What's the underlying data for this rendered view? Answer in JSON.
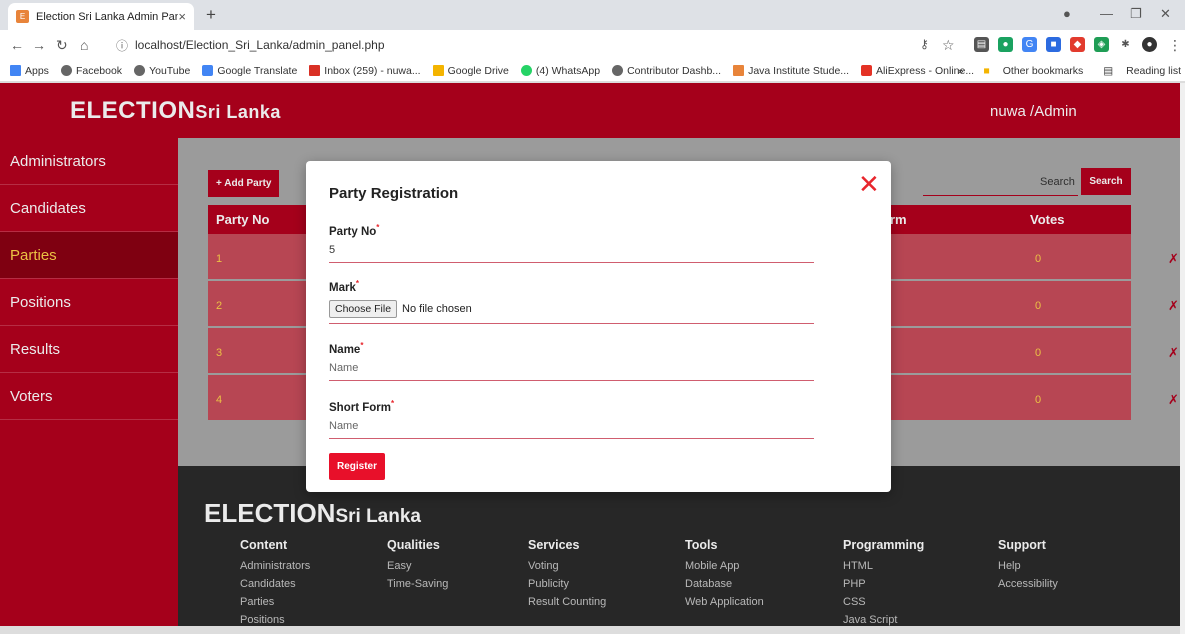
{
  "browser": {
    "tab_title": "Election Sri Lanka Admin Panel",
    "tab_close": "×",
    "new_tab": "+",
    "url": "localhost/Election_Sri_Lanka/admin_panel.php",
    "bookmarks": [
      "Apps",
      "Facebook",
      "YouTube",
      "Google Translate",
      "Inbox (259) - nuwa...",
      "Google Drive",
      "(4) WhatsApp",
      "Contributor Dashb...",
      "Java Institute Stude...",
      "AliExpress - Online..."
    ],
    "bookmarks_more": "»",
    "other_bookmarks": "Other bookmarks",
    "reading_list": "Reading list"
  },
  "header": {
    "brand_main": "ELECTION",
    "brand_sub": "Sri Lanka",
    "user": "nuwa /Admin"
  },
  "sidebar": {
    "items": [
      {
        "label": "Administrators"
      },
      {
        "label": "Candidates"
      },
      {
        "label": "Parties",
        "active": true
      },
      {
        "label": "Positions"
      },
      {
        "label": "Results"
      },
      {
        "label": "Voters"
      }
    ]
  },
  "main": {
    "add_button": "+ Add Party",
    "search_placeholder": "Search",
    "search_button": "Search",
    "columns": {
      "party_no": "Party No",
      "short_form_partial": "rm",
      "votes": "Votes"
    },
    "rows": [
      {
        "no": "1",
        "votes": "0"
      },
      {
        "no": "2",
        "votes": "0"
      },
      {
        "no": "3",
        "votes": "0"
      },
      {
        "no": "4",
        "votes": "0"
      }
    ],
    "delete_symbol": "✗"
  },
  "modal": {
    "title": "Party Registration",
    "close_symbol": "✕",
    "required_mark": "*",
    "fields": {
      "party_no_label": "Party No",
      "party_no_value": "5",
      "mark_label": "Mark",
      "file_button": "Choose File",
      "file_status": "No file chosen",
      "name_label": "Name",
      "name_placeholder": "Name",
      "short_form_label": "Short Form",
      "short_form_placeholder": "Name"
    },
    "register_button": "Register"
  },
  "footer": {
    "brand_main": "ELECTION",
    "brand_sub": "Sri Lanka",
    "columns": [
      {
        "heading": "Content",
        "items": [
          "Administrators",
          "Candidates",
          "Parties",
          "Positions"
        ]
      },
      {
        "heading": "Qualities",
        "items": [
          "Easy",
          "Time-Saving"
        ]
      },
      {
        "heading": "Services",
        "items": [
          "Voting",
          "Publicity",
          "Result Counting"
        ]
      },
      {
        "heading": "Tools",
        "items": [
          "Mobile App",
          "Database",
          "Web Application"
        ]
      },
      {
        "heading": "Programming",
        "items": [
          "HTML",
          "PHP",
          "CSS",
          "Java Script"
        ]
      },
      {
        "heading": "Support",
        "items": [
          "Help",
          "Accessibility"
        ]
      }
    ]
  },
  "colors": {
    "brand": "#b3001e",
    "active": "#8a0013",
    "highlight": "#ffd24a",
    "close": "#e8262d"
  }
}
